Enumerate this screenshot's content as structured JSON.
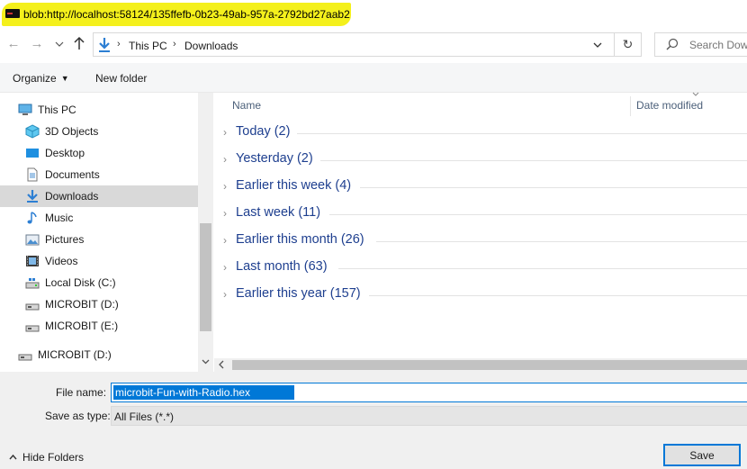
{
  "window": {
    "title": "blob:http://localhost:58124/135ffefb-0b23-49ab-957a-2792bd27aab2"
  },
  "navigation": {
    "back_glyph": "←",
    "forward_glyph": "→",
    "breadcrumbs": [
      "This PC",
      "Downloads"
    ],
    "refresh_glyph": "↻",
    "search_placeholder": "Search Downloads"
  },
  "toolbar": {
    "organize_label": "Organize",
    "new_folder_label": "New folder"
  },
  "sidebar": {
    "items": [
      {
        "label": "This PC",
        "icon": "computer-icon"
      },
      {
        "label": "3D Objects",
        "icon": "3d-objects-icon"
      },
      {
        "label": "Desktop",
        "icon": "desktop-icon"
      },
      {
        "label": "Documents",
        "icon": "documents-icon"
      },
      {
        "label": "Downloads",
        "icon": "downloads-icon",
        "selected": true
      },
      {
        "label": "Music",
        "icon": "music-icon"
      },
      {
        "label": "Pictures",
        "icon": "pictures-icon"
      },
      {
        "label": "Videos",
        "icon": "videos-icon"
      },
      {
        "label": "Local Disk (C:)",
        "icon": "local-disk-icon"
      },
      {
        "label": "MICROBIT (D:)",
        "icon": "drive-icon"
      },
      {
        "label": "MICROBIT (E:)",
        "icon": "drive-icon"
      },
      {
        "label": "MICROBIT (D:)",
        "icon": "drive-icon"
      }
    ]
  },
  "file_list": {
    "columns": {
      "name": "Name",
      "date_modified": "Date modified"
    },
    "groups": [
      "Today (2)",
      "Yesterday (2)",
      "Earlier this week (4)",
      "Last week (11)",
      "Earlier this month (26)",
      "Last month (63)",
      "Earlier this year (157)"
    ]
  },
  "save_panel": {
    "file_name_label": "File name:",
    "file_name_value": "microbit-Fun-with-Radio.hex",
    "save_as_type_label": "Save as type:",
    "save_as_type_value": "All Files (*.*)",
    "hide_folders_label": "Hide Folders",
    "save_label": "Save"
  },
  "colors": {
    "title_highlight": "#f4f01c",
    "group_text": "#1e3f8f",
    "selection": "#0078d7",
    "selected_tree_item": "#d9d9d9"
  }
}
